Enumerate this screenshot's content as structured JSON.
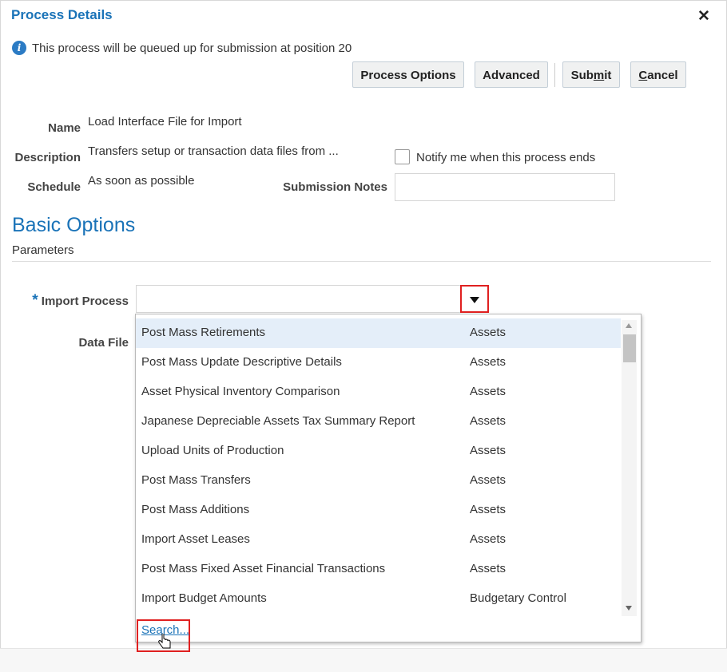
{
  "dialog": {
    "title": "Process Details",
    "close_glyph": "✕",
    "info_message": "This process will be queued up for submission at position 20"
  },
  "toolbar": {
    "process_options": "Process Options",
    "advanced": "Advanced",
    "submit_pre": "Sub",
    "submit_u": "m",
    "submit_post": "it",
    "cancel_u": "C",
    "cancel_post": "ancel"
  },
  "details": {
    "name_label": "Name",
    "name_value": "Load Interface File for Import",
    "description_label": "Description",
    "description_value": "Transfers setup or transaction data files from ...",
    "schedule_label": "Schedule",
    "schedule_value": "As soon as possible",
    "notify_label": "Notify me when this process ends",
    "notify_checked": false,
    "submission_notes_label": "Submission Notes",
    "submission_notes_value": ""
  },
  "basic_options": {
    "heading": "Basic Options",
    "subheading": "Parameters",
    "required_marker": "*",
    "import_process_label": "Import Process",
    "import_process_value": "",
    "data_file_label": "Data File"
  },
  "dropdown": {
    "items": [
      {
        "name": "Post Mass Retirements",
        "category": "Assets"
      },
      {
        "name": "Post Mass Update Descriptive Details",
        "category": "Assets"
      },
      {
        "name": "Asset Physical Inventory Comparison",
        "category": "Assets"
      },
      {
        "name": "Japanese Depreciable Assets Tax Summary Report",
        "category": "Assets"
      },
      {
        "name": "Upload Units of Production",
        "category": "Assets"
      },
      {
        "name": "Post Mass Transfers",
        "category": "Assets"
      },
      {
        "name": "Post Mass Additions",
        "category": "Assets"
      },
      {
        "name": "Import Asset Leases",
        "category": "Assets"
      },
      {
        "name": "Post Mass Fixed Asset Financial Transactions",
        "category": "Assets"
      },
      {
        "name": "Import Budget Amounts",
        "category": "Budgetary Control"
      }
    ],
    "search_link": "Search...",
    "highlight_color": "#e02020",
    "accent_color": "#1a73b8"
  }
}
